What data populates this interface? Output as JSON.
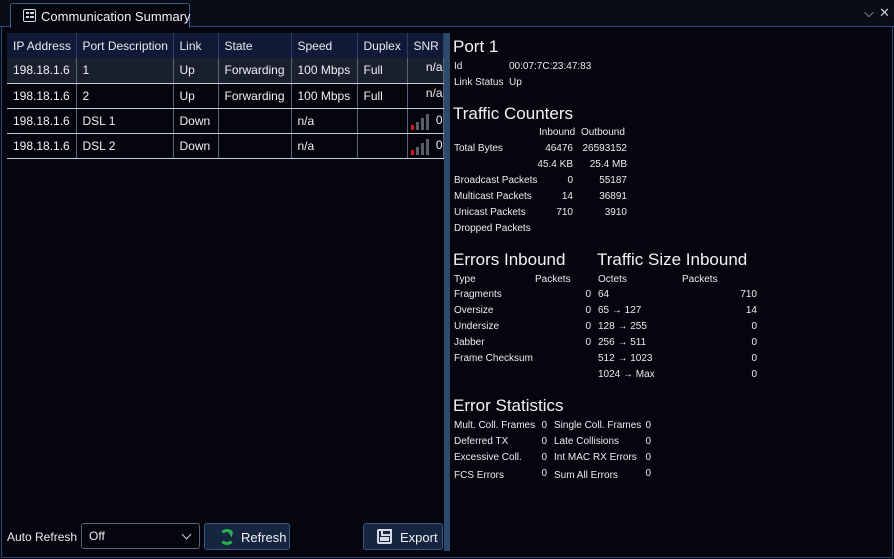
{
  "tab": {
    "title": "Communication Summary",
    "icon": "dashboard-icon"
  },
  "window": {
    "chevron": "⌵",
    "close": "✕"
  },
  "table": {
    "headers": [
      "IP Address",
      "Port Description",
      "Link",
      "State",
      "Speed",
      "Duplex",
      "SNR"
    ],
    "rows": [
      {
        "ip": "198.18.1.6",
        "port": "1",
        "link": "Up",
        "state": "Forwarding",
        "speed": "100 Mbps",
        "duplex": "Full",
        "snr": "n/a"
      },
      {
        "ip": "198.18.1.6",
        "port": "2",
        "link": "Up",
        "state": "Forwarding",
        "speed": "100 Mbps",
        "duplex": "Full",
        "snr": "n/a"
      },
      {
        "ip": "198.18.1.6",
        "port": "DSL 1",
        "link": "Down",
        "state": "",
        "speed": "n/a",
        "duplex": "",
        "snr": "0"
      },
      {
        "ip": "198.18.1.6",
        "port": "DSL 2",
        "link": "Down",
        "state": "",
        "speed": "n/a",
        "duplex": "",
        "snr": "0"
      }
    ]
  },
  "detail": {
    "port_title": "Port 1",
    "id_label": "Id",
    "id_value": "00:07:7C:23:47:83",
    "link_status_label": "Link Status",
    "link_status_value": "Up",
    "traffic": {
      "title": "Traffic Counters",
      "inbound": "Inbound",
      "outbound": "Outbound",
      "total_bytes_label": "Total Bytes",
      "total_bytes_in": "46476",
      "total_bytes_out": "26593152",
      "total_bytes_in_fmt": "45.4 KB",
      "total_bytes_out_fmt": "25.4 MB",
      "broadcast_label": "Broadcast Packets",
      "broadcast_in": "0",
      "broadcast_out": "55187",
      "multicast_label": "Multicast Packets",
      "multicast_in": "14",
      "multicast_out": "36891",
      "unicast_label": "Unicast Packets",
      "unicast_in": "710",
      "unicast_out": "3910",
      "dropped_label": "Dropped Packets"
    },
    "errors_inbound": {
      "title": "Errors Inbound",
      "type_header": "Type",
      "packets_header": "Packets",
      "rows": [
        {
          "label": "Fragments",
          "value": "0"
        },
        {
          "label": "Oversize",
          "value": "0"
        },
        {
          "label": "Undersize",
          "value": "0"
        },
        {
          "label": "Jabber",
          "value": "0"
        },
        {
          "label": "Frame Checksum",
          "value": ""
        }
      ]
    },
    "traffic_size": {
      "title": "Traffic Size Inbound",
      "octets_header": "Octets",
      "packets_header": "Packets",
      "rows": [
        {
          "label": "64",
          "value": "710"
        },
        {
          "label": "65 → 127",
          "value": "14"
        },
        {
          "label": "128 → 255",
          "value": "0"
        },
        {
          "label": "256 → 511",
          "value": "0"
        },
        {
          "label": "512 → 1023",
          "value": "0"
        },
        {
          "label": "1024 → Max",
          "value": "0"
        }
      ]
    },
    "error_stats": {
      "title": "Error Statistics",
      "left": [
        {
          "label": "Mult. Coll. Frames",
          "value": "0"
        },
        {
          "label": "Deferred TX",
          "value": "0"
        },
        {
          "label": "Excessive Coll.",
          "value": "0"
        },
        {
          "label": "FCS Errors",
          "value": "0"
        }
      ],
      "right": [
        {
          "label": "Single Coll. Frames",
          "value": "0"
        },
        {
          "label": "Late Collisions",
          "value": "0"
        },
        {
          "label": "Int MAC RX Errors",
          "value": "0"
        },
        {
          "label": "Sum All Errors",
          "value": "0"
        }
      ]
    }
  },
  "controls": {
    "auto_refresh_label": "Auto Refresh",
    "auto_refresh_value": "Off",
    "refresh_label": "Refresh",
    "export_label": "Export"
  },
  "colors": {
    "accent": "#2a4a78",
    "signal_red": "#d41818",
    "refresh_green": "#28b04a"
  }
}
